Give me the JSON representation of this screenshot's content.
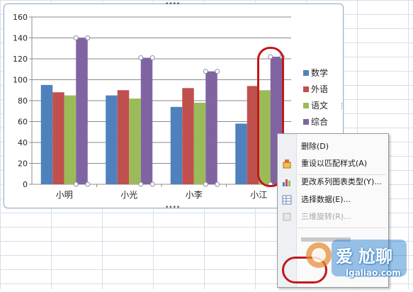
{
  "chart_data": {
    "type": "bar",
    "categories": [
      "小明",
      "小光",
      "小李",
      "小江"
    ],
    "series": [
      {
        "name": "数学",
        "values": [
          95,
          85,
          74,
          58
        ],
        "color": "#4f81bd"
      },
      {
        "name": "外语",
        "values": [
          88,
          90,
          92,
          94
        ],
        "color": "#c0504d"
      },
      {
        "name": "语文",
        "values": [
          85,
          82,
          78,
          90
        ],
        "color": "#9bbb59"
      },
      {
        "name": "综合",
        "values": [
          140,
          121,
          108,
          122
        ],
        "color": "#8064a2"
      }
    ],
    "yticks": [
      0,
      20,
      40,
      60,
      80,
      100,
      120,
      140,
      160
    ],
    "ylim": [
      0,
      160
    ],
    "grid": true,
    "legend": "right",
    "title": "",
    "xlabel": "",
    "ylabel": ""
  },
  "context_menu": {
    "items": [
      {
        "label": "删除(D)",
        "icon": "delete-icon",
        "enabled": true
      },
      {
        "label": "重设以匹配样式(A)",
        "icon": "reset-style-icon",
        "enabled": true
      },
      {
        "label": "更改系列图表类型(Y)...",
        "icon": "chart-type-icon",
        "enabled": true
      },
      {
        "label": "选择数据(E)...",
        "icon": "select-data-icon",
        "enabled": true
      },
      {
        "label": "三维旋转(R)...",
        "icon": "rotate-3d-icon",
        "enabled": false
      }
    ]
  },
  "watermark": {
    "line1": "爱",
    "line2": "尬聊",
    "url": "lgaliao.com"
  }
}
